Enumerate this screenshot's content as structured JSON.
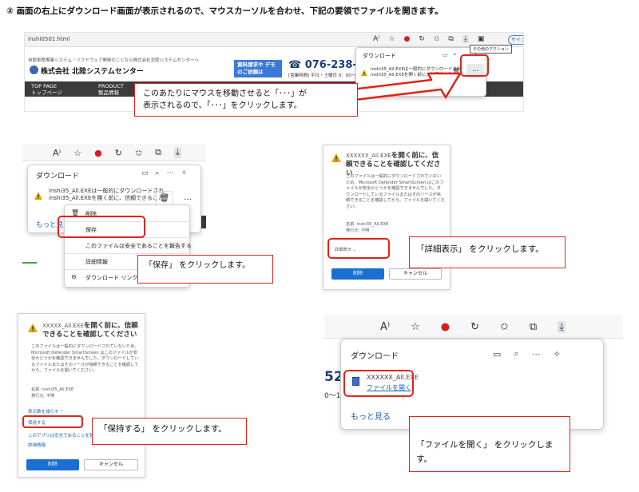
{
  "heading": "② 画面の右上にダウンロード画面が表示されるので、マウスカーソルを合わせ、下記の要領でファイルを開きます。",
  "colors": {
    "red_highlight": "#e2231a",
    "link_blue": "#1a5fb4",
    "primary_button": "#1a6fd0",
    "nav_dark": "#3b3b3b",
    "warning_yellow": "#e0a800"
  },
  "panel1": {
    "url": "inshi0501.html",
    "site_tagline": "自動車整備業システム・ソフトウェア開発のことなら株式会社北陸システムセンターへ",
    "company": "株式会社 北陸システムセンター",
    "doc_button": "資料請求や デモのご依頼は",
    "phone": "☎ 076-238-52",
    "hours": "[営業時間] 平日・土曜日 9：00～",
    "nav": [
      {
        "en": "TOP PAGE",
        "ja": "トップページ"
      },
      {
        "en": "PRODUCT",
        "ja": "製品情報"
      }
    ],
    "search_stub": "サイン",
    "download": {
      "title": "ダウンロード",
      "line1": "inshi35_All.EXEは一般的にダウンロードされ",
      "line2": "inshi35_All.EXEを開く前に、信頼できること",
      "more": "…",
      "tooltip": "その他のアクション"
    },
    "callout": "このあたりにマウスを移動させると「･･･」が\n表示されるので、「･･･」をクリックします。"
  },
  "panel2": {
    "download": {
      "title": "ダウンロード",
      "line1": "inshi35_All.EXEは一般的にダウンロードされ",
      "line2": "inshi35_All.EXEを開く前に、信頼できること",
      "more": "…",
      "show_more": "もっと見る"
    },
    "menu": {
      "delete": "削除",
      "keep": "保存",
      "report": "このファイルは安全であることを報告する",
      "details": "詳細情報",
      "copy_link": "ダウンロード リンクのコピ"
    },
    "callout": "「保存」 をクリックします。"
  },
  "panel3": {
    "title_prefix": "XXXXXX_All.EXE",
    "title_rest": "を開く前に、信頼できることを確認してください",
    "body": "このファイルは一般的にダウンロードされていないため、Microsoft Defender SmartScreen はこのファイルが安全かどうかを確認できませんでした。ダウンロードしているファイルまたはそのソースが信頼できることを確認してから、ファイルを開いてください。",
    "name_label": "名前: inshi35_All.EXE",
    "publisher_label": "発行元: 不明",
    "show_details": "詳細表示",
    "delete_btn": "削除",
    "cancel_btn": "キャンセル",
    "callout": "「詳細表示」 をクリックします。"
  },
  "panel4": {
    "title_prefix": "XXXXX_All.EXE",
    "title_rest": "を開く前に、信頼できることを確認してください",
    "body": "このファイルは一般的にダウンロードされていないため、Microsoft Defender SmartScreen はこのファイルが安全かどうかを確認できませんでした。ダウンロードしているファイルまたはそのソースが信頼できることを確認してから、ファイルを開いてください。",
    "name_label": "名前: inshi35_All.EXE",
    "publisher_label": "発行元: 不明",
    "show_less": "表示数を減らす",
    "keep": "保持する",
    "report_safe": "このアプリは安全であることを報告する",
    "details": "詳細情報",
    "delete_btn": "削除",
    "cancel_btn": "キャンセル",
    "callout": "「保持する」 をクリックします。"
  },
  "panel5": {
    "left_num": "52",
    "left_sub": "0～1",
    "download": {
      "title": "ダウンロード",
      "filename": "XXXXXX_All.EXE",
      "open_file": "ファイルを開く",
      "show_more": "もっと見る"
    },
    "callout": "「ファイルを開く」 をクリックします。"
  }
}
